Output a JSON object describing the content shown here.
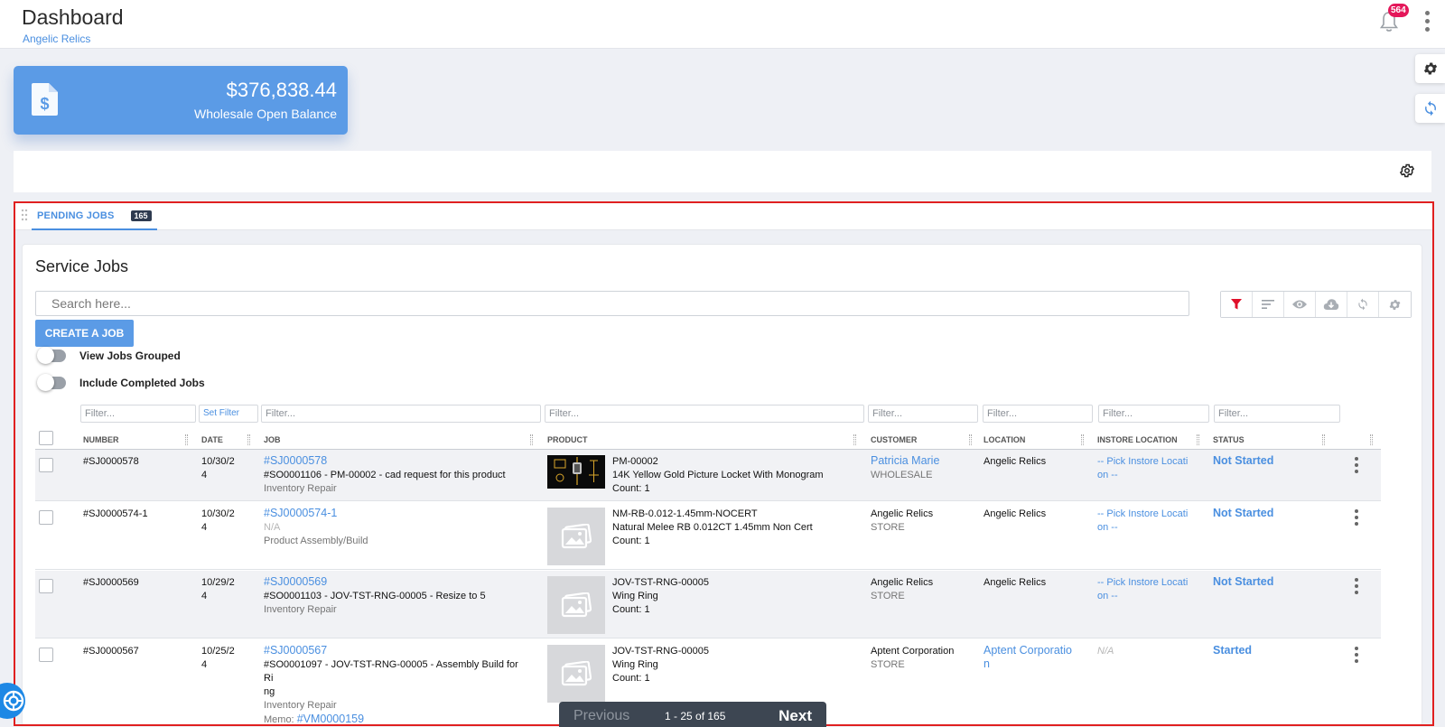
{
  "header": {
    "title": "Dashboard",
    "subtitle": "Angelic Relics",
    "notification_count": "564",
    "icons": [
      "bell-icon",
      "more-vert-icon",
      "gear-icon",
      "sync-icon"
    ]
  },
  "balance_card": {
    "amount": "$376,838.44",
    "label": "Wholesale Open Balance",
    "icon": "invoice-dollar-icon",
    "color": "#5b9be6"
  },
  "tabs": [
    {
      "label": "PENDING JOBS",
      "count": "165",
      "active": true
    }
  ],
  "service_jobs": {
    "title": "Service Jobs",
    "search_placeholder": "Search here...",
    "create_label": "CREATE A JOB",
    "toggles": [
      {
        "label": "View Jobs Grouped",
        "on": false
      },
      {
        "label": "Include Completed Jobs",
        "on": false
      }
    ],
    "toolbar_icons": [
      "filter-icon",
      "sort-icon",
      "eye-icon",
      "cloud-download-icon",
      "refresh-icon",
      "settings-icon"
    ],
    "filters": {
      "number": "Filter...",
      "date": "Set Filter",
      "job": "Filter...",
      "product": "Filter...",
      "customer": "Filter...",
      "location": "Filter...",
      "instore": "Filter...",
      "status": "Filter..."
    },
    "columns": {
      "number": "NUMBER",
      "date": "DATE",
      "job": "JOB",
      "product": "PRODUCT",
      "customer": "CUSTOMER",
      "location": "LOCATION",
      "instore": "INSTORE LOCATION",
      "status": "STATUS"
    },
    "rows": [
      {
        "number": "#SJ0000578",
        "date_line1": "10/30/2",
        "date_line2": "4",
        "job_link": "#SJ0000578",
        "job_desc": "#SO0001106 - PM-00002 - cad request for this product",
        "job_type": "Inventory Repair",
        "product_sku": "PM-00002",
        "product_name": "14K Yellow Gold Picture Locket With Monogram",
        "product_count": "Count: 1",
        "customer": "Patricia Marie",
        "customer_type": "WHOLESALE",
        "location": "Angelic Relics",
        "instore_line1": "-- Pick Instore Locati",
        "instore_line2": "on --",
        "status": "Not Started"
      },
      {
        "number": "#SJ0000574-1",
        "date_line1": "10/30/2",
        "date_line2": "4",
        "job_link": "#SJ0000574-1",
        "job_desc": "N/A",
        "job_type": "Product Assembly/Build",
        "product_sku": "NM-RB-0.012-1.45mm-NOCERT",
        "product_name": "Natural Melee RB 0.012CT 1.45mm Non Cert",
        "product_count": "Count: 1",
        "customer": "Angelic Relics",
        "customer_type": "STORE",
        "location": "Angelic Relics",
        "instore_line1": "-- Pick Instore Locati",
        "instore_line2": "on --",
        "status": "Not Started"
      },
      {
        "number": "#SJ0000569",
        "date_line1": "10/29/2",
        "date_line2": "4",
        "job_link": "#SJ0000569",
        "job_desc": "#SO0001103 - JOV-TST-RNG-00005 - Resize to 5",
        "job_type": "Inventory Repair",
        "product_sku": "JOV-TST-RNG-00005",
        "product_name": "Wing Ring",
        "product_count": "Count: 1",
        "customer": "Angelic Relics",
        "customer_type": "STORE",
        "location": "Angelic Relics",
        "instore_line1": "-- Pick Instore Locati",
        "instore_line2": "on --",
        "status": "Not Started"
      },
      {
        "number": "#SJ0000567",
        "date_line1": "10/25/2",
        "date_line2": "4",
        "job_link": "#SJ0000567",
        "job_desc_line1": "#SO0001097 - JOV-TST-RNG-00005 - Assembly Build for Ri",
        "job_desc_line2": "ng",
        "job_type": "Inventory Repair",
        "memo_label": "Memo:",
        "memo_link": "#VM0000159",
        "product_sku": "JOV-TST-RNG-00005",
        "product_name": "Wing Ring",
        "product_count": "Count: 1",
        "customer": "Aptent Corporation",
        "customer_type": "STORE",
        "location_line1": "Aptent Corporatio",
        "location_line2": "n",
        "instore": "N/A",
        "status": "Started"
      }
    ]
  },
  "pagination": {
    "prev": "Previous",
    "info": "1 - 25 of 165",
    "next": "Next"
  },
  "colors": {
    "accent": "#4a8fe0",
    "badge": "#e4175a",
    "highlight_border": "#e02020",
    "filter_active": "#e0102a"
  }
}
